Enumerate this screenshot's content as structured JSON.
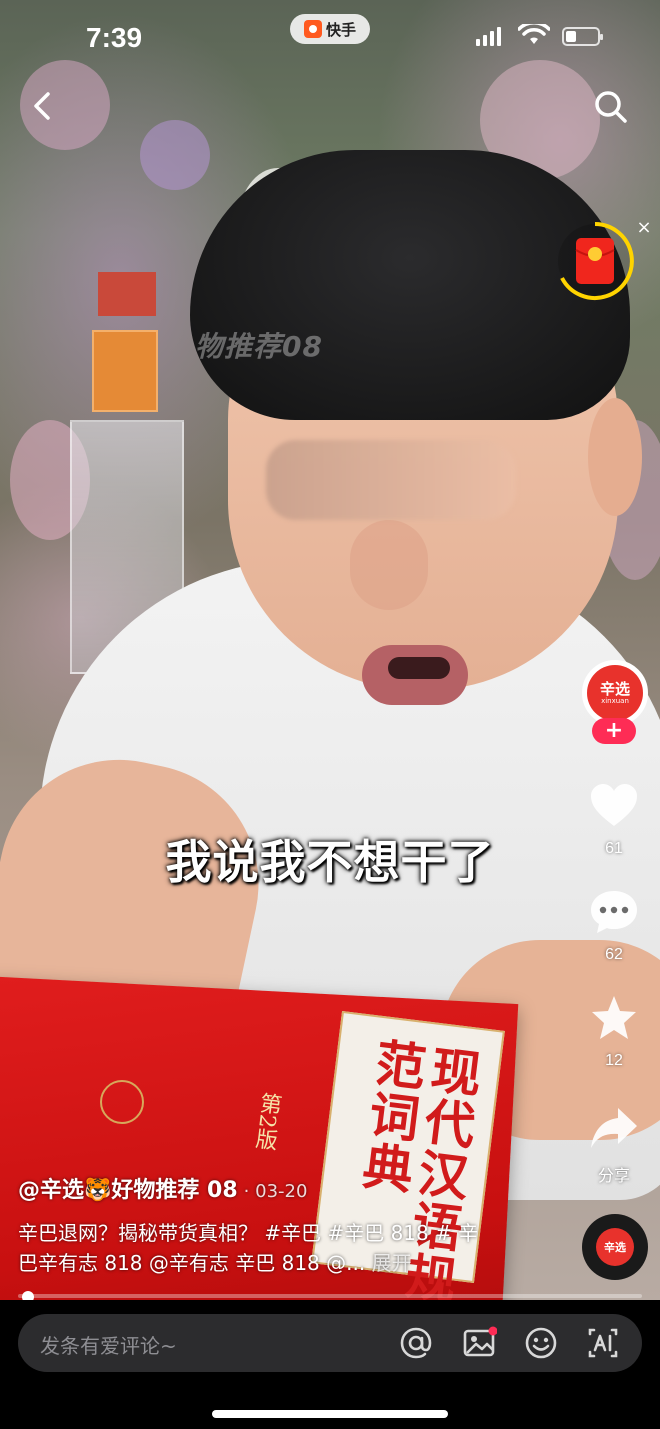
{
  "status_bar": {
    "time": "7:39",
    "app_badge": "快手"
  },
  "video": {
    "watermark": "物推荐08",
    "subtitle": "我说我不想干了"
  },
  "creator": {
    "avatar_name": "辛选",
    "avatar_sub": "xinxuan",
    "follow_label": "+"
  },
  "actions": {
    "like_count": "61",
    "comment_count": "62",
    "favorite_count": "12",
    "share_label": "分享"
  },
  "caption": {
    "username": "@辛选🐯好物推荐 08",
    "date": "· 03-20",
    "text": "辛巴退网？揭秘带货真相？ #辛巴 #辛巴 818 # 辛巴辛有志 818 @辛有志 辛巴 818 @...",
    "more_label": "展开"
  },
  "playback": {
    "progress": 0.01
  },
  "music_disc": {
    "label": "辛选"
  },
  "comment_bar": {
    "placeholder": "发条有爱评论~"
  },
  "icons": {
    "back": "back-arrow-icon",
    "search": "search-icon",
    "red_packet": "red-packet-icon",
    "like": "heart-icon",
    "comment": "comment-bubble-icon",
    "favorite": "star-icon",
    "share": "share-arrow-icon",
    "mention": "at-icon",
    "image": "image-icon",
    "emoji": "emoji-icon",
    "ai": "ai-icon"
  },
  "colors": {
    "accent": "#fe2c55",
    "brand_red": "#e8322c",
    "red_packet_ring": "#ffd400"
  }
}
